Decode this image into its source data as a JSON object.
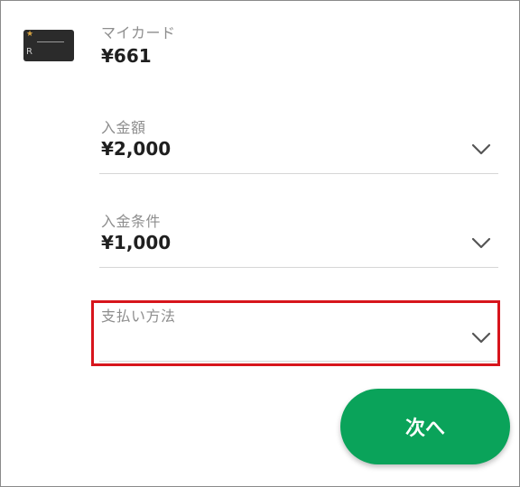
{
  "card": {
    "label": "マイカード",
    "balance": "¥661"
  },
  "amount": {
    "label": "入金額",
    "value": "¥2,000"
  },
  "condition": {
    "label": "入金条件",
    "value": "¥1,000"
  },
  "payment": {
    "label": "支払い方法",
    "value": ""
  },
  "next_button": {
    "label": "次へ"
  },
  "colors": {
    "accent": "#0aa35a",
    "highlight": "#d7151c"
  },
  "icons": {
    "card": "card-thumbnail-icon",
    "dropdown": "chevron-down-icon"
  }
}
